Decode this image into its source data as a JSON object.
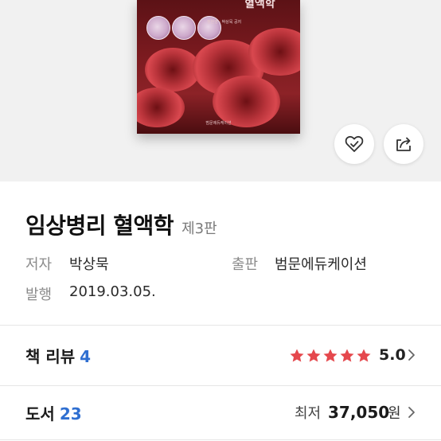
{
  "cover": {
    "title_fragment": "혈액학",
    "subtitle": "정현영 · 박상묵 공저",
    "publisher": "범문에듀케이션"
  },
  "actions": {
    "wishlist_icon": "heart-check-icon",
    "share_icon": "share-icon"
  },
  "book": {
    "title": "임상병리 혈액학",
    "edition": "제3판",
    "author_label": "저자",
    "author": "박상묵",
    "publisher_label": "출판",
    "publisher": "범문에듀케이션",
    "date_label": "발행",
    "date": "2019.03.05."
  },
  "reviews": {
    "label": "책 리뷰",
    "count": "4",
    "rating": 5.0,
    "rating_text": "5.0",
    "stars": 5,
    "star_color": "#e5484d"
  },
  "listings": {
    "label": "도서",
    "count": "23",
    "price_label": "최저",
    "price": "37,050",
    "unit": "원"
  },
  "colors": {
    "accent_blue": "#2f6fd1"
  }
}
